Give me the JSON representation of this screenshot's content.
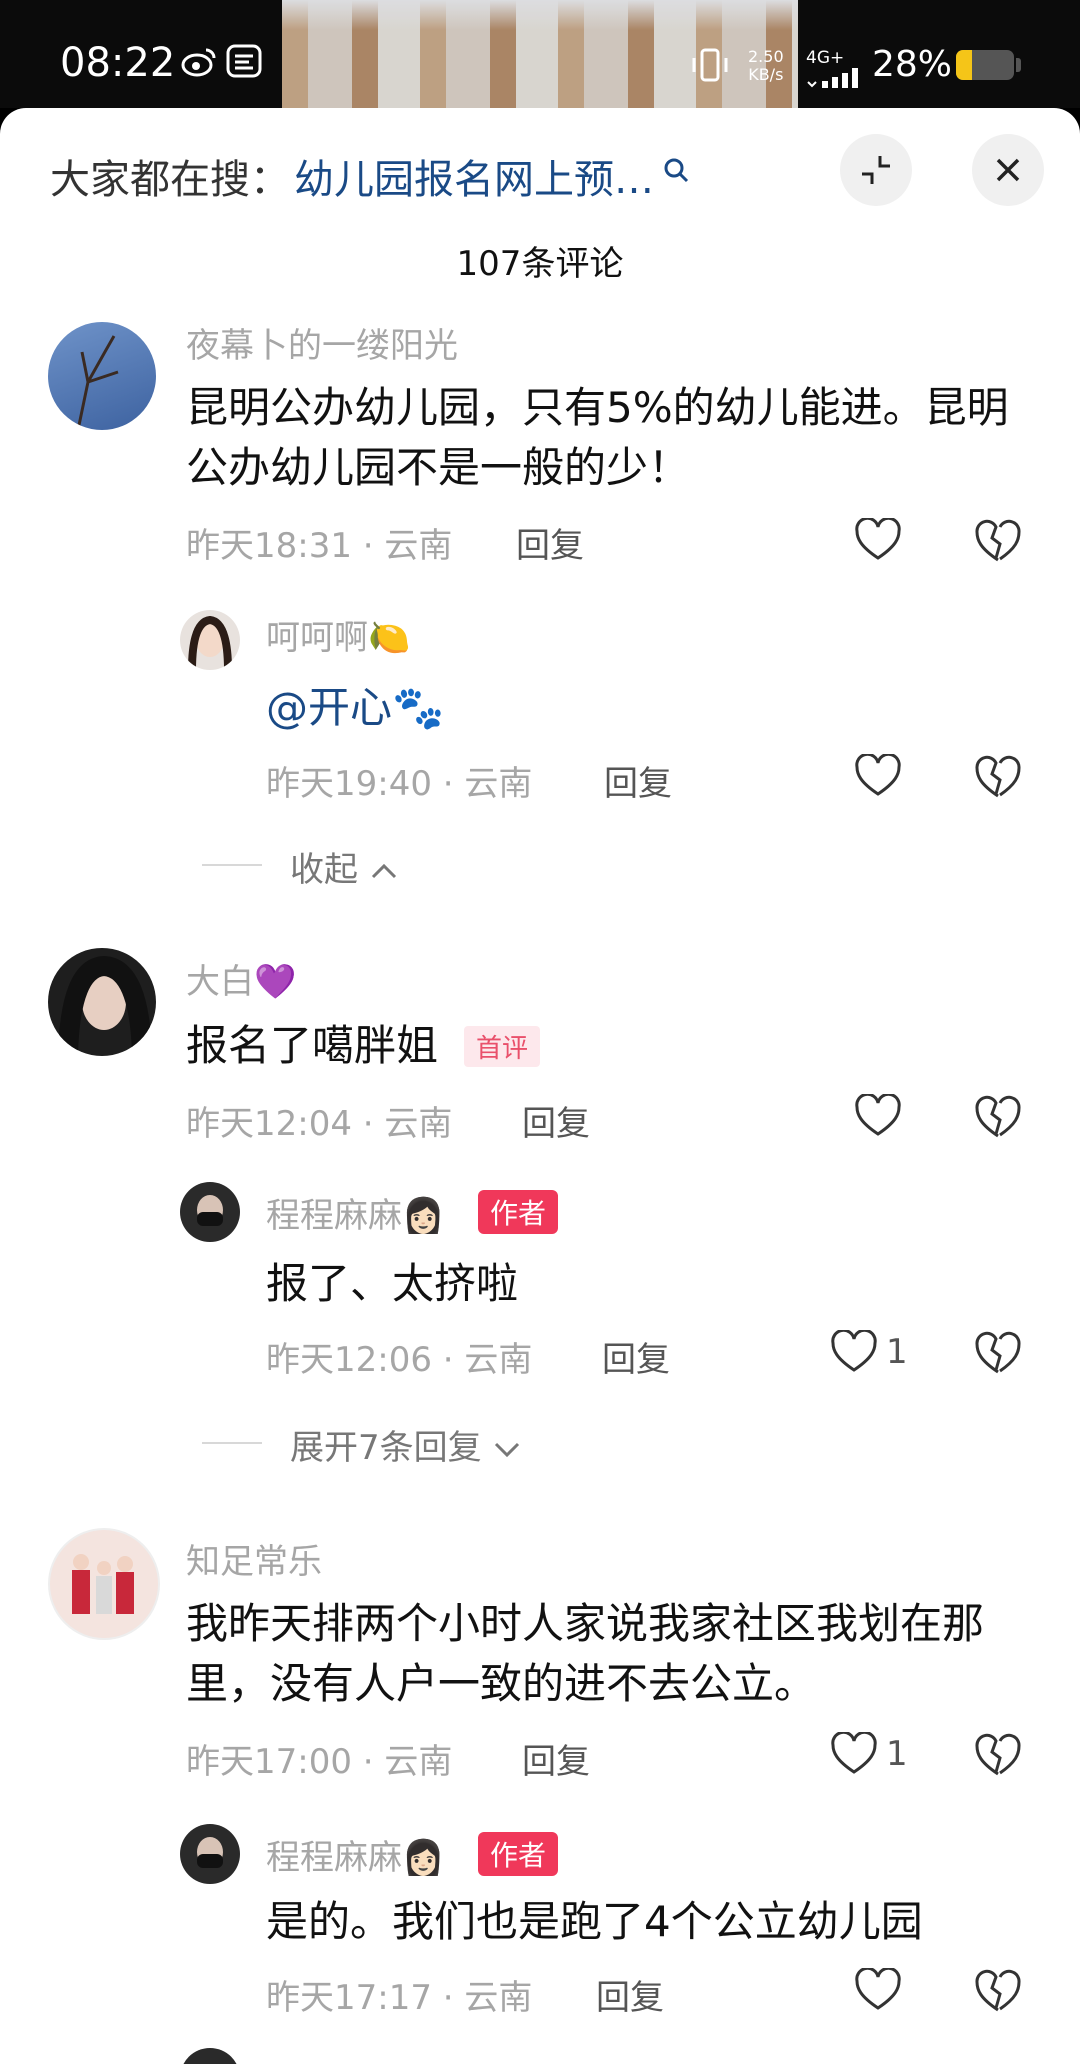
{
  "status_bar": {
    "time": "08:22",
    "net_speed_value": "2.50",
    "net_speed_unit": "KB/s",
    "network": "4G+",
    "battery": "28%",
    "battery_level": 0.28,
    "battery_color": "#f5c518"
  },
  "header": {
    "search_prefix": "大家都在搜：",
    "search_query": "幼儿园报名网上预…",
    "comment_count": "107条评论"
  },
  "comments": [
    {
      "username": "夜幕卜的一缕阳光",
      "text": "昆明公办幼儿园，只有5%的幼儿能进。昆明公办幼儿园不是一般的少！",
      "time": "昨天18:31 · 云南",
      "reply_label": "回复",
      "replies": [
        {
          "username": "呵呵啊🍋",
          "mention": "@开心🐾",
          "time": "昨天19:40 · 云南",
          "reply_label": "回复"
        }
      ],
      "collapse_label": "收起"
    },
    {
      "username": "大白💜",
      "text": "报名了噶胖姐",
      "badge": "首评",
      "time": "昨天12:04 · 云南",
      "reply_label": "回复",
      "replies": [
        {
          "username": "程程麻麻👩🏻",
          "badge": "作者",
          "text": "报了、太挤啦",
          "time": "昨天12:06 · 云南",
          "reply_label": "回复",
          "likes": "1"
        }
      ],
      "expand_label": "展开7条回复"
    },
    {
      "username": "知足常乐",
      "text": "我昨天排两个小时人家说我家社区我划在那里，没有人户一致的进不去公立。",
      "time": "昨天17:00 · 云南",
      "reply_label": "回复",
      "likes": "1",
      "replies": [
        {
          "username": "程程麻麻👩🏻",
          "badge": "作者",
          "text": "是的。我们也是跑了4个公立幼儿园",
          "time": "昨天17:17 · 云南",
          "reply_label": "回复"
        }
      ]
    }
  ]
}
